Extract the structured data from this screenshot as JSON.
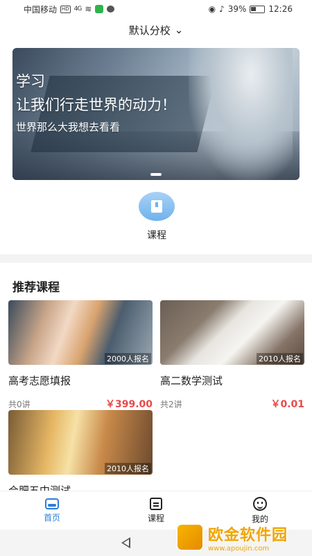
{
  "status_bar": {
    "carrier": "中国移动",
    "hd": "HD",
    "signal": "4G",
    "battery": "39%",
    "time": "12:26"
  },
  "header": {
    "campus": "默认分校"
  },
  "banner": {
    "line1": "学习",
    "line2": "让我们行走世界的动力！",
    "line3": "世界那么大我想去看看"
  },
  "course_entry": {
    "label": "课程"
  },
  "section": {
    "title": "推荐课程"
  },
  "courses": [
    {
      "title": "高考志愿填报",
      "signups": "2000人报名",
      "lessons": "共0讲",
      "price": "￥399.00"
    },
    {
      "title": "高二数学测试",
      "signups": "2010人报名",
      "lessons": "共2讲",
      "price": "￥0.01"
    },
    {
      "title": "合肥五中测试",
      "signups": "2010人报名"
    }
  ],
  "nav": {
    "items": [
      {
        "label": "首页",
        "icon": "home-icon"
      },
      {
        "label": "课程",
        "icon": "calendar-icon"
      },
      {
        "label": "我的",
        "icon": "smile-icon"
      }
    ]
  },
  "watermark": {
    "text": "欧金软件园",
    "url": "www.apoujin.com"
  },
  "colors": {
    "accent": "#2b7fd8",
    "price": "#e84a4a"
  }
}
